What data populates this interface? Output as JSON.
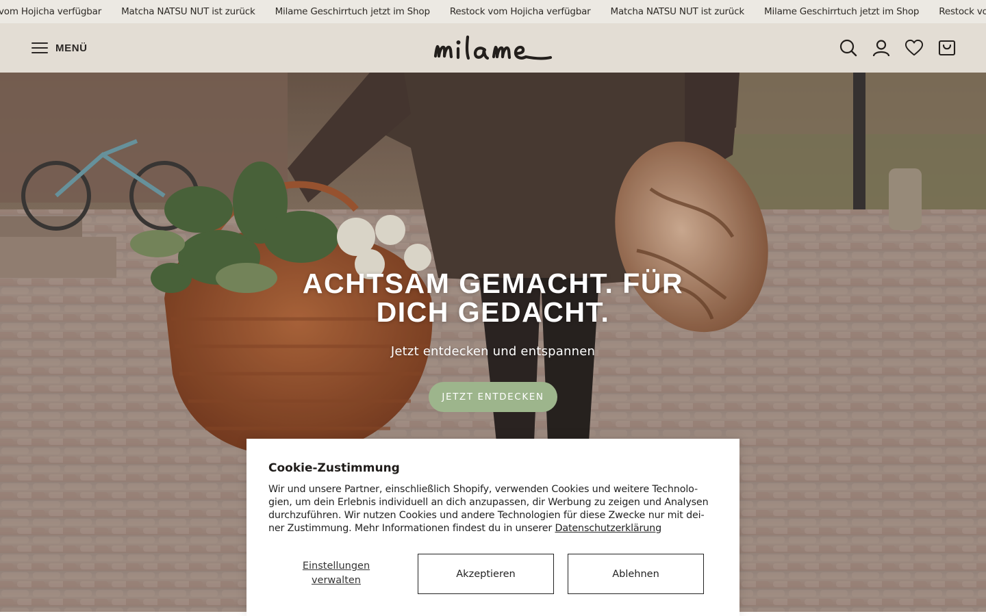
{
  "announcement": {
    "items": [
      "vom Hojicha verfügbar",
      "Matcha NATSU NUT ist zurück",
      "Milame Geschirrtuch jetzt im Shop",
      "Restock vom Hojicha verfügbar",
      "Matcha NATSU NUT ist zurück",
      "Milame Geschirrtuch jetzt im Shop",
      "Restock vom Hojicha verfügbar"
    ]
  },
  "header": {
    "menu_label": "MENÜ",
    "logo_text": "milame",
    "icons": [
      "search-icon",
      "account-icon",
      "wishlist-heart-icon",
      "cart-bag-icon"
    ]
  },
  "hero": {
    "title_line1": "ACHTSAM GEMACHT. FÜR",
    "title_line2": "DICH GEDACHT.",
    "subtitle": "Jetzt entdecken und entspannen",
    "cta_label": "JETZT ENTDECKEN",
    "cta_color": "#9db58c"
  },
  "cookie": {
    "title": "Cookie-Zustimmung",
    "text_line1": "Wir und unsere Partner, einschließlich Shopify, verwenden Cookies und weitere Technolo-",
    "text_line2": "gien, um dein Erlebnis individuell an dich anzupassen, dir Werbung zu zeigen und Analysen",
    "text_line3": "durchzuführen. Wir nutzen Cookies und andere Technologien für diese Zwecke nur mit dei-",
    "text_line4": "ner Zustimmung. Mehr Informationen findest du in unserer ",
    "privacy_link": "Datenschutzerklärung",
    "manage_line1": "Einstellungen",
    "manage_line2": "verwalten",
    "accept_label": "Akzeptieren",
    "decline_label": "Ablehnen"
  }
}
